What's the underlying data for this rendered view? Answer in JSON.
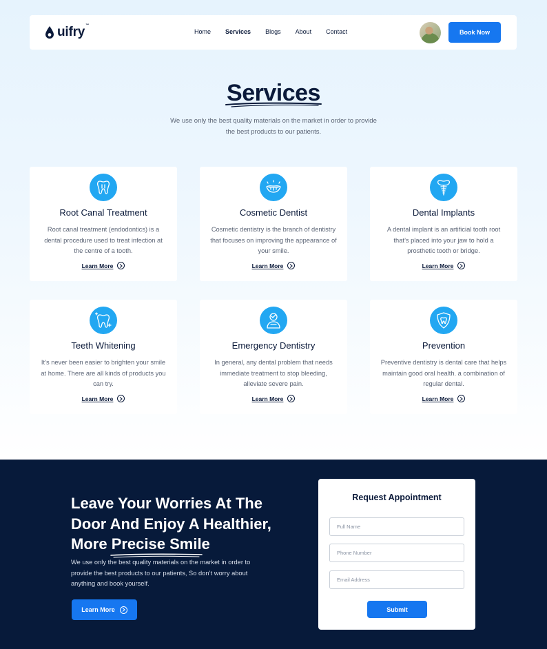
{
  "brand": {
    "name": "uifry",
    "tm": "™"
  },
  "nav": {
    "items": [
      {
        "label": "Home",
        "active": false
      },
      {
        "label": "Services",
        "active": true
      },
      {
        "label": "Blogs",
        "active": false
      },
      {
        "label": "About",
        "active": false
      },
      {
        "label": "Contact",
        "active": false
      }
    ],
    "book_label": "Book Now"
  },
  "services": {
    "title": "Services",
    "subtitle": "We use only the best quality materials on the market in order to provide the best products to our patients.",
    "learn_label": "Learn More",
    "cards": [
      {
        "title": "Root Canal Treatment",
        "text": "Root canal treatment (endodontics) is a dental procedure used to treat infection at the centre of a tooth.",
        "icon": "tooth-icon"
      },
      {
        "title": "Cosmetic Dentist",
        "text": "Cosmetic dentistry is the branch of dentistry that focuses on improving the appearance of your smile.",
        "icon": "smile-icon"
      },
      {
        "title": "Dental Implants",
        "text": "A dental implant is an artificial tooth root that’s placed into your jaw to hold a prosthetic tooth or bridge.",
        "icon": "implant-icon"
      },
      {
        "title": "Teeth Whitening",
        "text": "It’s never been easier to brighten your smile at home. There are all kinds of products you can try.",
        "icon": "sparkle-tooth-icon"
      },
      {
        "title": "Emergency Dentistry",
        "text": "In general, any dental problem that needs immediate treatment to stop bleeding, alleviate severe pain.",
        "icon": "emergency-dentist-icon"
      },
      {
        "title": "Prevention",
        "text": "Preventive dentistry is dental care that helps maintain good oral health. a combination of regular dental.",
        "icon": "shield-tooth-icon"
      }
    ]
  },
  "cta": {
    "title_before": "Leave Your Worries At The Door And Enjoy A Healthier, More ",
    "title_highlight": "Precise Smi",
    "title_after": "le",
    "text": "We use only the best quality materials on the market in order to provide the best products to our patients, So don’t worry about anything and book yourself.",
    "button_label": "Learn More"
  },
  "form": {
    "title": "Request Appointment",
    "full_name_placeholder": "Full Name",
    "phone_placeholder": "Phone Number",
    "email_placeholder": "Email Address",
    "submit_label": "Submit"
  },
  "colors": {
    "primary": "#1677f0",
    "icon_bg": "#22a7f2",
    "navy": "#0b1a3a",
    "dark_section": "#071a3a"
  }
}
